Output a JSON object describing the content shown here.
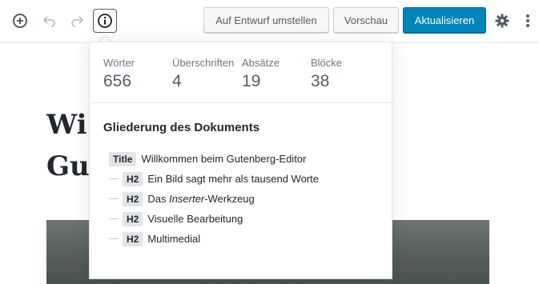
{
  "toolbar": {
    "draft_label": "Auf Entwurf umstellen",
    "preview_label": "Vorschau",
    "update_label": "Aktualisieren",
    "primary_color": "#0085ba"
  },
  "editor": {
    "title_line1": "Wi",
    "title_line2": "Gu"
  },
  "popover": {
    "stats": {
      "words_label": "Wörter",
      "words_value": "656",
      "headings_label": "Überschriften",
      "headings_value": "4",
      "paragraphs_label": "Absätze",
      "paragraphs_value": "19",
      "blocks_label": "Blöcke",
      "blocks_value": "38"
    },
    "outline_heading": "Gliederung des Dokuments",
    "outline": [
      {
        "level": "Title",
        "text": "Willkommen beim Gutenberg-Editor"
      },
      {
        "level": "H2",
        "text": "Ein Bild sagt mehr als tausend Worte"
      },
      {
        "level": "H2",
        "text_before": "Das ",
        "text_italic": "Inserter",
        "text_after": "-Werkzeug"
      },
      {
        "level": "H2",
        "text": "Visuelle Bearbeitung"
      },
      {
        "level": "H2",
        "text": "Multimedial"
      }
    ]
  }
}
